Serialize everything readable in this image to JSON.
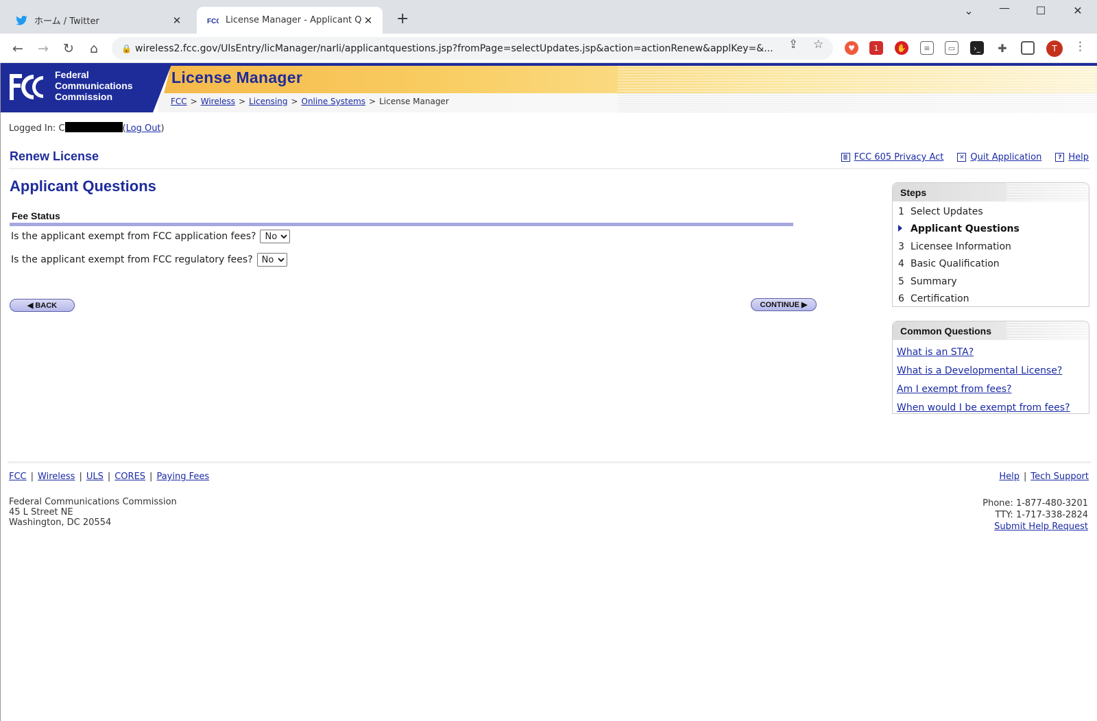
{
  "browser": {
    "tabs": [
      {
        "title": "ホーム / Twitter",
        "active": false
      },
      {
        "title": "License Manager - Applicant Que",
        "active": true
      }
    ],
    "url": "wireless2.fcc.gov/UlsEntry/licManager/narli/applicantquestions.jsp?fromPage=selectUpdates.jsp&action=actionRenew&applKey=&...",
    "profile_initial": "T",
    "ext_badge": "1",
    "twitter_color": "#1d9bf0",
    "brand_color": "#1e2c9a"
  },
  "header": {
    "org_line1": "Federal",
    "org_line2": "Communications",
    "org_line3": "Commission",
    "app_title": "License Manager",
    "breadcrumb": {
      "items": [
        "FCC",
        "Wireless",
        "Licensing",
        "Online Systems"
      ],
      "current": "License Manager",
      "separator": ">"
    }
  },
  "session": {
    "logged_in_label": "Logged In:",
    "user_prefix": "C",
    "logout_label": "Log Out"
  },
  "section": {
    "title": "Renew License",
    "links": {
      "privacy": "FCC 605 Privacy Act",
      "quit": "Quit Application",
      "help": "Help"
    }
  },
  "main": {
    "page_title": "Applicant Questions",
    "fee_status_heading": "Fee Status",
    "questions": [
      {
        "label": "Is the applicant exempt from FCC application fees?",
        "value": "No"
      },
      {
        "label": "Is the applicant exempt from FCC regulatory fees?",
        "value": "No"
      }
    ],
    "back_label": "BACK",
    "continue_label": "CONTINUE"
  },
  "sidebar": {
    "steps_title": "Steps",
    "steps": [
      {
        "num": "1",
        "label": "Select Updates"
      },
      {
        "num": "",
        "label": "Applicant Questions",
        "current": true
      },
      {
        "num": "3",
        "label": "Licensee Information"
      },
      {
        "num": "4",
        "label": "Basic Qualification"
      },
      {
        "num": "5",
        "label": "Summary"
      },
      {
        "num": "6",
        "label": "Certification"
      }
    ],
    "cq_title": "Common Questions",
    "common_questions": [
      "What is an STA?",
      "What is a Developmental License?",
      "Am I exempt from fees?",
      "When would I be exempt from fees?"
    ]
  },
  "footer": {
    "links": [
      "FCC",
      "Wireless",
      "ULS",
      "CORES",
      "Paying Fees"
    ],
    "right_links": [
      "Help",
      "Tech Support"
    ],
    "address": [
      "Federal Communications Commission",
      "45 L Street NE",
      "Washington, DC 20554"
    ],
    "phone_label": "Phone:",
    "phone": "1-877-480-3201",
    "tty_label": "TTY:",
    "tty": "1-717-338-2824",
    "help_request": "Submit Help Request"
  }
}
